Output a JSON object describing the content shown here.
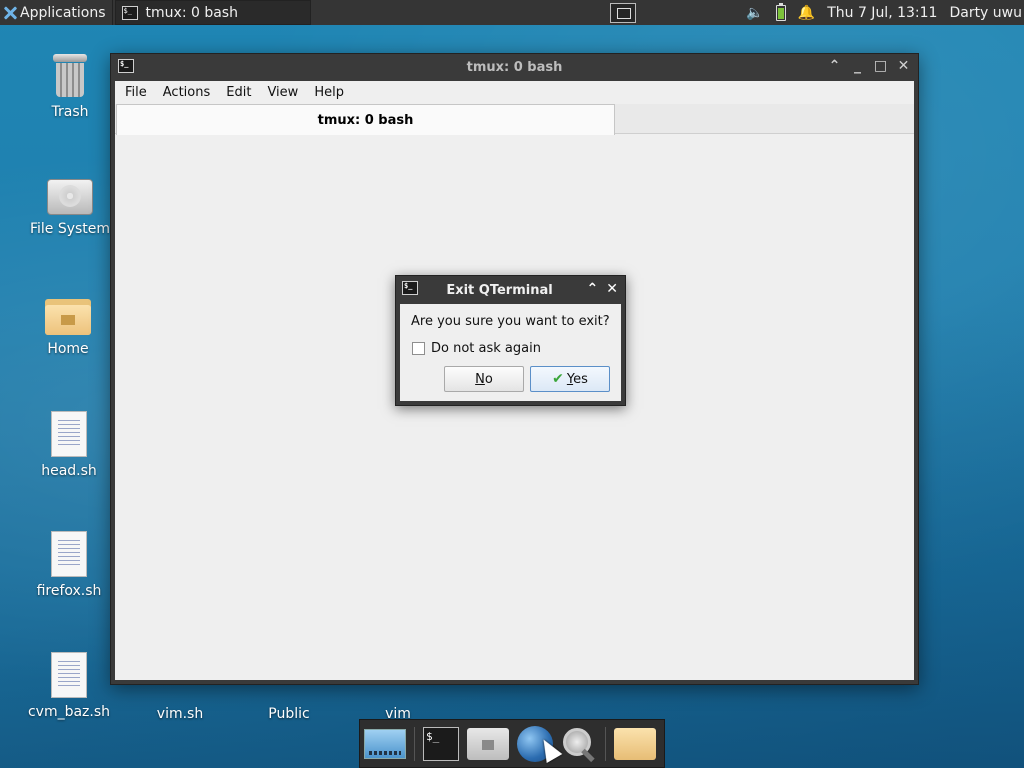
{
  "top_panel": {
    "apps_label": "Applications",
    "task_label": "tmux: 0 bash",
    "clock": "Thu  7 Jul, 13:11",
    "user": "Darty uwu"
  },
  "desktop_icons": [
    {
      "label": "Trash"
    },
    {
      "label": "File System"
    },
    {
      "label": "Home"
    },
    {
      "label": "head.sh"
    },
    {
      "label": "firefox.sh"
    },
    {
      "label": "cvm_baz.sh"
    },
    {
      "label": "vim.sh"
    },
    {
      "label": "Public"
    },
    {
      "label": "vim"
    }
  ],
  "window": {
    "title": "tmux: 0 bash",
    "menu": [
      "File",
      "Actions",
      "Edit",
      "View",
      "Help"
    ],
    "tab_label": "tmux: 0 bash"
  },
  "dialog": {
    "title": "Exit QTerminal",
    "message": "Are you sure you want to exit?",
    "checkbox_label": "Do not ask again",
    "checkbox_checked": false,
    "no_button": {
      "mnemonic": "N",
      "rest": "o"
    },
    "yes_button": {
      "mnemonic": "Y",
      "rest": "es"
    }
  },
  "colors": {
    "desktop": "#1f7fae",
    "panel": "#353535",
    "window_body": "#efefef",
    "yes_border": "#5b8fc8"
  }
}
